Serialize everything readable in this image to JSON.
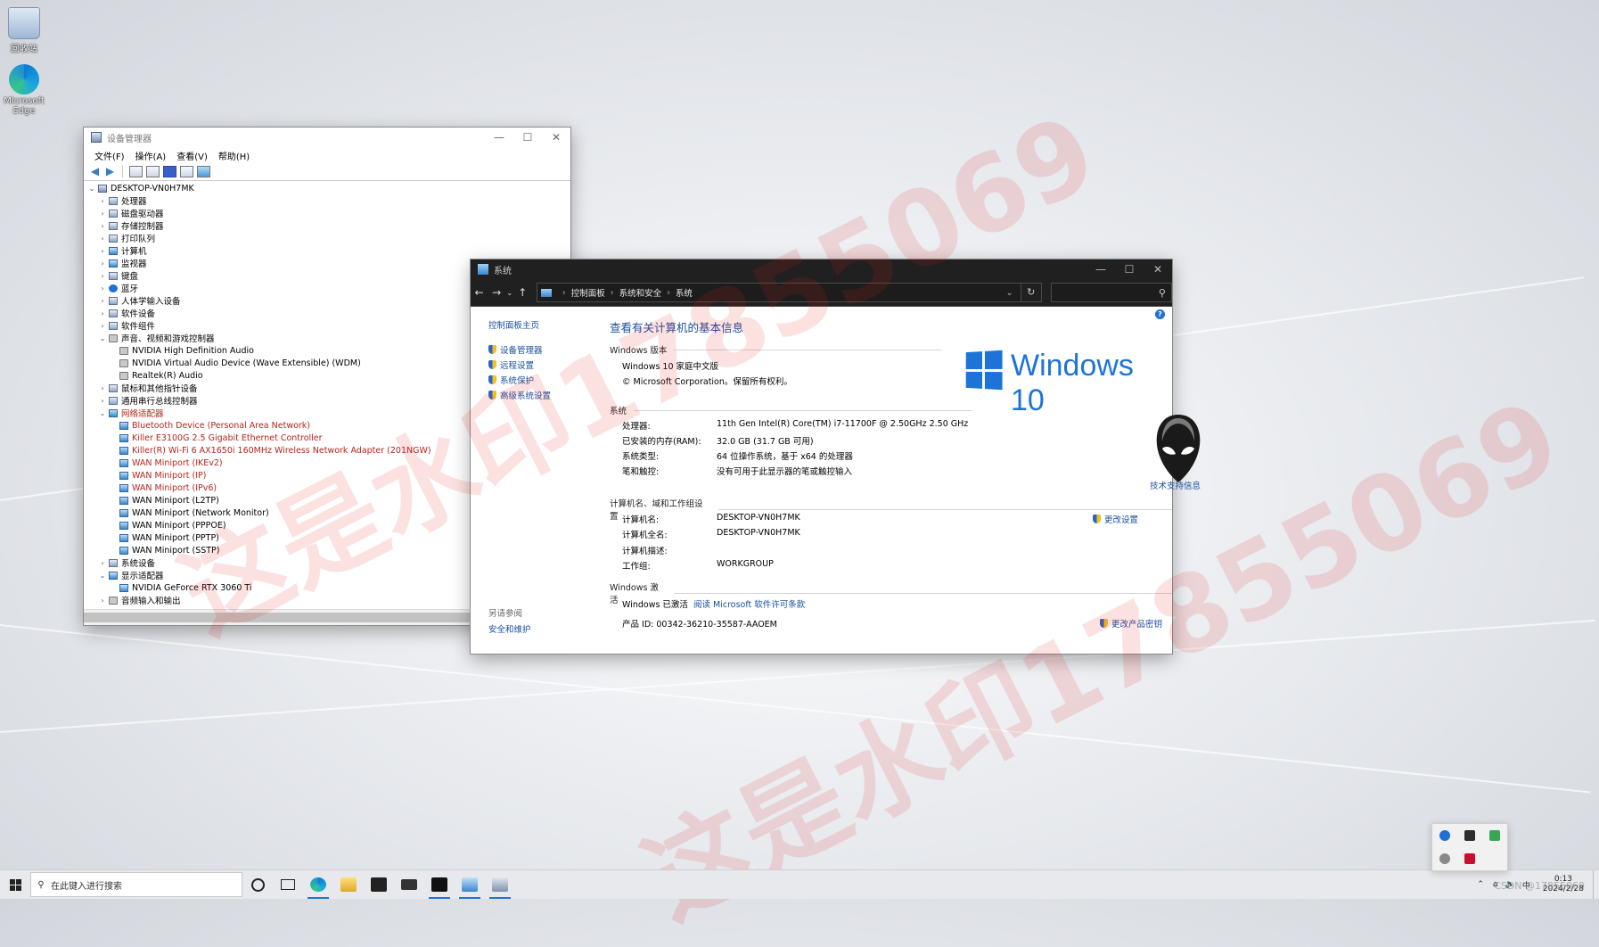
{
  "desktop": {
    "icons": [
      {
        "label": "回收站",
        "icon": "recycle-bin-icon"
      },
      {
        "label": "Microsoft Edge",
        "icon": "edge-icon"
      }
    ]
  },
  "watermark": {
    "text1": "这是水印17855069",
    "text2": "这是水印17855069",
    "corner": "CSDN @17855069"
  },
  "devmgr": {
    "title": "设备管理器",
    "menu": [
      "文件(F)",
      "操作(A)",
      "查看(V)",
      "帮助(H)"
    ],
    "root": "DESKTOP-VN0H7MK",
    "rows": [
      {
        "t": "处理器",
        "lvl": 1,
        "exp": "closed",
        "icon": "default"
      },
      {
        "t": "磁盘驱动器",
        "lvl": 1,
        "exp": "closed",
        "icon": "default"
      },
      {
        "t": "存储控制器",
        "lvl": 1,
        "exp": "closed",
        "icon": "default"
      },
      {
        "t": "打印队列",
        "lvl": 1,
        "exp": "closed",
        "icon": "default"
      },
      {
        "t": "计算机",
        "lvl": 1,
        "exp": "closed",
        "icon": "display"
      },
      {
        "t": "监视器",
        "lvl": 1,
        "exp": "closed",
        "icon": "display"
      },
      {
        "t": "键盘",
        "lvl": 1,
        "exp": "closed",
        "icon": "default"
      },
      {
        "t": "蓝牙",
        "lvl": 1,
        "exp": "closed",
        "icon": "bt"
      },
      {
        "t": "人体学输入设备",
        "lvl": 1,
        "exp": "closed",
        "icon": "default"
      },
      {
        "t": "软件设备",
        "lvl": 1,
        "exp": "closed",
        "icon": "default"
      },
      {
        "t": "软件组件",
        "lvl": 1,
        "exp": "closed",
        "icon": "default"
      },
      {
        "t": "声音、视频和游戏控制器",
        "lvl": 1,
        "exp": "open",
        "icon": "audio"
      },
      {
        "t": "NVIDIA High Definition Audio",
        "lvl": 2,
        "icon": "audio"
      },
      {
        "t": "NVIDIA Virtual Audio Device (Wave Extensible) (WDM)",
        "lvl": 2,
        "icon": "audio"
      },
      {
        "t": "Realtek(R) Audio",
        "lvl": 2,
        "icon": "audio"
      },
      {
        "t": "鼠标和其他指针设备",
        "lvl": 1,
        "exp": "closed",
        "icon": "default"
      },
      {
        "t": "通用串行总线控制器",
        "lvl": 1,
        "exp": "closed",
        "icon": "default"
      },
      {
        "t": "网络适配器",
        "lvl": 1,
        "exp": "open",
        "icon": "net",
        "red": true
      },
      {
        "t": "Bluetooth Device (Personal Area Network)",
        "lvl": 2,
        "icon": "net",
        "red": true
      },
      {
        "t": "Killer E3100G 2.5 Gigabit Ethernet Controller",
        "lvl": 2,
        "icon": "net",
        "red": true
      },
      {
        "t": "Killer(R) Wi-Fi 6 AX1650i 160MHz Wireless Network Adapter (201NGW)",
        "lvl": 2,
        "icon": "net",
        "red": true
      },
      {
        "t": "WAN Miniport (IKEv2)",
        "lvl": 2,
        "icon": "net",
        "red": true
      },
      {
        "t": "WAN Miniport (IP)",
        "lvl": 2,
        "icon": "net",
        "red": true
      },
      {
        "t": "WAN Miniport (IPv6)",
        "lvl": 2,
        "icon": "net",
        "red": true
      },
      {
        "t": "WAN Miniport (L2TP)",
        "lvl": 2,
        "icon": "net"
      },
      {
        "t": "WAN Miniport (Network Monitor)",
        "lvl": 2,
        "icon": "net"
      },
      {
        "t": "WAN Miniport (PPPOE)",
        "lvl": 2,
        "icon": "net"
      },
      {
        "t": "WAN Miniport (PPTP)",
        "lvl": 2,
        "icon": "net"
      },
      {
        "t": "WAN Miniport (SSTP)",
        "lvl": 2,
        "icon": "net"
      },
      {
        "t": "系统设备",
        "lvl": 1,
        "exp": "closed",
        "icon": "default"
      },
      {
        "t": "显示适配器",
        "lvl": 1,
        "exp": "open",
        "icon": "display"
      },
      {
        "t": "NVIDIA GeForce RTX 3060 Ti",
        "lvl": 2,
        "icon": "display"
      },
      {
        "t": "音频输入和输出",
        "lvl": 1,
        "exp": "closed",
        "icon": "audio"
      }
    ]
  },
  "sysw": {
    "title": "系统",
    "breadcrumb": [
      "控制面板",
      "系统和安全",
      "系统"
    ],
    "side": {
      "home": "控制面板主页",
      "links": [
        "设备管理器",
        "远程设置",
        "系统保护",
        "高级系统设置"
      ],
      "see_also": "另请参阅",
      "security": "安全和维护"
    },
    "heading": "查看有关计算机的基本信息",
    "edition_header": "Windows 版本",
    "edition": "Windows 10 家庭中文版",
    "copyright": "© Microsoft Corporation。保留所有权利。",
    "logo_text": "Windows 10",
    "system_header": "系统",
    "system": [
      {
        "label": "处理器:",
        "value": "11th Gen Intel(R) Core(TM) i7-11700F @ 2.50GHz   2.50 GHz"
      },
      {
        "label": "已安装的内存(RAM):",
        "value": "32.0 GB (31.7 GB 可用)"
      },
      {
        "label": "系统类型:",
        "value": "64 位操作系统，基于 x64 的处理器"
      },
      {
        "label": "笔和触控:",
        "value": "没有可用于此显示器的笔或触控输入"
      }
    ],
    "support": "技术支持信息",
    "name_header": "计算机名、域和工作组设置",
    "name": [
      {
        "label": "计算机名:",
        "value": "DESKTOP-VN0H7MK"
      },
      {
        "label": "计算机全名:",
        "value": "DESKTOP-VN0H7MK"
      },
      {
        "label": "计算机描述:",
        "value": ""
      },
      {
        "label": "工作组:",
        "value": "WORKGROUP"
      }
    ],
    "change_settings": "更改设置",
    "activation_header": "Windows 激活",
    "activated": "Windows 已激活",
    "license_link": "阅读 Microsoft 软件许可条款",
    "product_id": "产品 ID: 00342-36210-35587-AAOEM",
    "change_key": "更改产品密钥"
  },
  "taskbar": {
    "search_placeholder": "在此键入进行搜索",
    "time": "0:13",
    "date": "2024/2/28",
    "ime": "中"
  }
}
